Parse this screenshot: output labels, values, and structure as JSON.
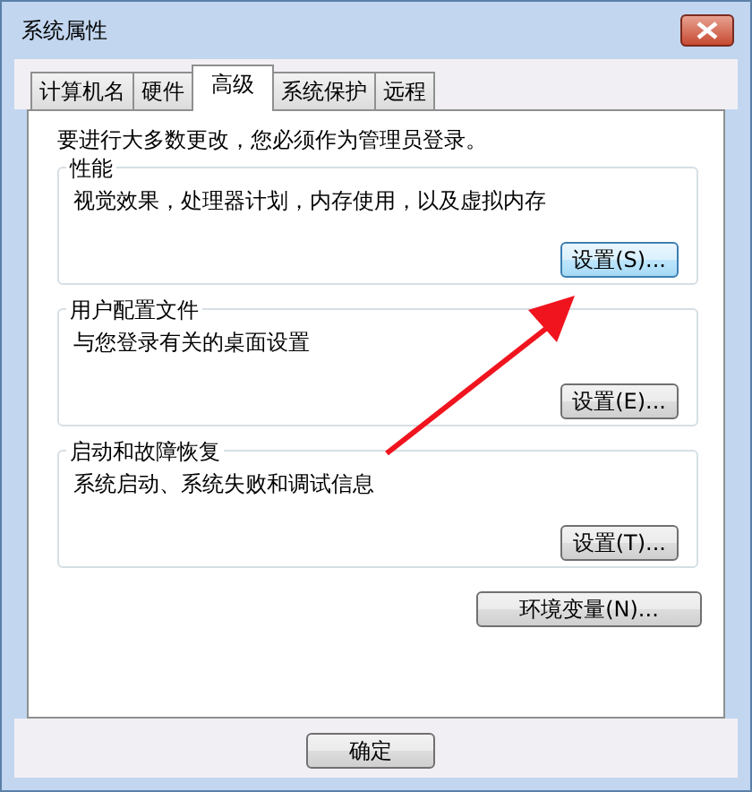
{
  "window": {
    "title": "系统属性"
  },
  "tabs": [
    {
      "label": "计算机名",
      "selected": false
    },
    {
      "label": "硬件",
      "selected": false
    },
    {
      "label": "高级",
      "selected": true
    },
    {
      "label": "系统保护",
      "selected": false
    },
    {
      "label": "远程",
      "selected": false
    }
  ],
  "notice": "要进行大多数更改，您必须作为管理员登录。",
  "groups": [
    {
      "title": "性能",
      "description": "视觉效果，处理器计划，内存使用，以及虚拟内存",
      "button": "设置(S)...",
      "focused": true
    },
    {
      "title": "用户配置文件",
      "description": "与您登录有关的桌面设置",
      "button": "设置(E)...",
      "focused": false
    },
    {
      "title": "启动和故障恢复",
      "description": "系统启动、系统失败和调试信息",
      "button": "设置(T)...",
      "focused": false
    }
  ],
  "env_button": "环境变量(N)...",
  "dialog_buttons": [
    "确定"
  ]
}
